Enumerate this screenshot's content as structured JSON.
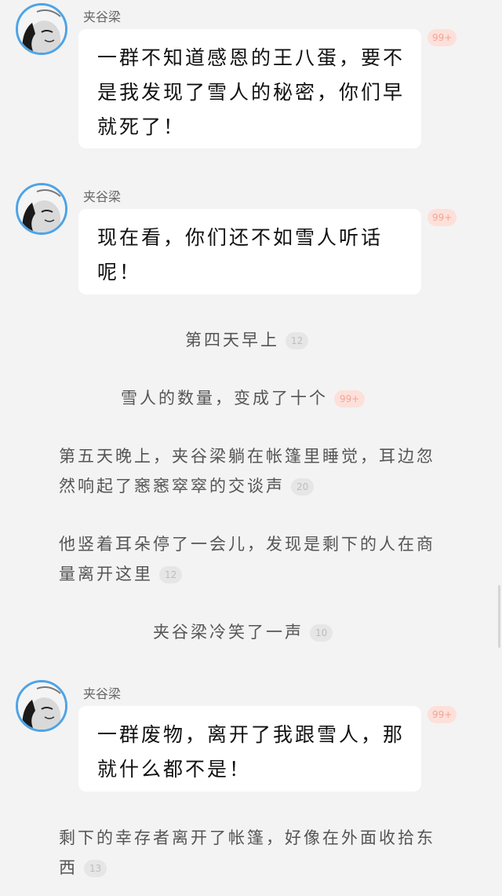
{
  "messages": [
    {
      "speaker": "夹谷梁",
      "text": "一群不知道感恩的王八蛋，要不是我发现了雪人的秘密，你们早就死了！",
      "count": "99+"
    },
    {
      "speaker": "夹谷梁",
      "text": "现在看，你们还不如雪人听话呢！",
      "count": "99+"
    },
    {
      "speaker": "夹谷梁",
      "text": "一群废物，离开了我跟雪人，那就什么都不是！",
      "count": "99+"
    }
  ],
  "narration": [
    {
      "text": "第四天早上",
      "count": "12"
    },
    {
      "text": "雪人的数量，变成了十个",
      "count": "99+"
    },
    {
      "text": "第五天晚上，夹谷梁躺在帐篷里睡觉，耳边忽然响起了窸窸窣窣的交谈声",
      "count": "20"
    },
    {
      "text": "他竖着耳朵停了一会儿，发现是剩下的人在商量离开这里",
      "count": "12"
    },
    {
      "text": "夹谷梁冷笑了一声",
      "count": "10"
    },
    {
      "text": "剩下的幸存者离开了帐篷，好像在外面收拾东西",
      "count": "13"
    }
  ],
  "icons": {
    "avatar": "avatar-portrait-icon"
  },
  "colors": {
    "avatar_ring": "#4ea3e6",
    "badge_hot": "#fde0da",
    "badge_gray": "#e6e6e6"
  }
}
